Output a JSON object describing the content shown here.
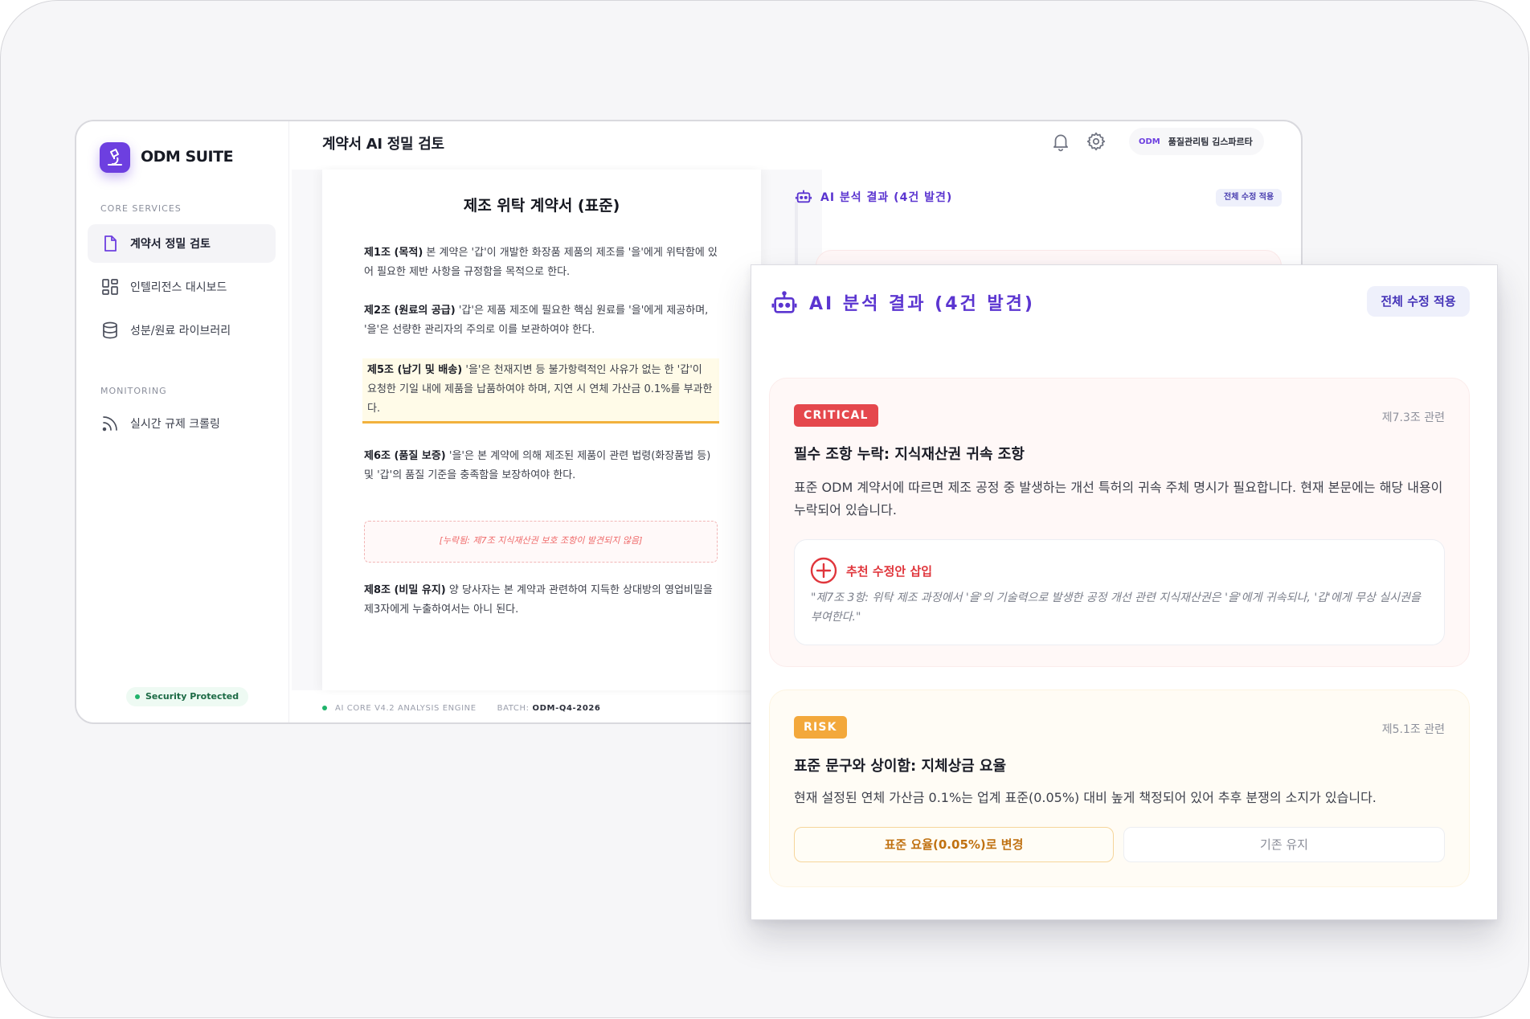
{
  "app": {
    "name": "ODM SUITE",
    "page_title": "계약서 AI 정밀 검토"
  },
  "sidebar": {
    "section_core": "CORE SERVICES",
    "section_monitoring": "MONITORING",
    "items": [
      {
        "label": "계약서 정밀 검토",
        "icon": "document-icon",
        "active": true
      },
      {
        "label": "인텔리전스 대시보드",
        "icon": "dashboard-grid-icon"
      },
      {
        "label": "성분/원료 라이브러리",
        "icon": "database-icon"
      },
      {
        "label": "실시간 규제 크롤링",
        "icon": "rss-feed-icon"
      }
    ],
    "security_label": "Security Protected"
  },
  "header": {
    "user_badge": "ODM",
    "user_name": "품질관리팀 김스파르타",
    "icons": [
      "bell-icon",
      "gear-icon"
    ]
  },
  "document": {
    "title": "제조 위탁 계약서 (표준)",
    "clauses": [
      {
        "head": "제1조 (목적)",
        "text": " 본 계약은 '갑'이 개발한 화장품 제품의 제조를 '을'에게 위탁함에 있어 필요한 제반 사항을 규정함을 목적으로 한다."
      },
      {
        "head": "제2조 (원료의 공급)",
        "text": " '갑'은 제품 제조에 필요한 핵심 원료를 '을'에게 제공하며, '을'은 선량한 관리자의 주의로 이를 보관하여야 한다."
      },
      {
        "head": "제5조 (납기 및 배송)",
        "text": " '을'은 천재지변 등 불가항력적인 사유가 없는 한 '갑'이 요청한 기일 내에 제품을 납품하여야 하며, 지연 시 연체 가산금 0.1%를 부과한다."
      },
      {
        "head": "제6조 (품질 보증)",
        "text": " '을'은 본 계약에 의해 제조된 제품이 관련 법령(화장품법 등) 및 '갑'의 품질 기준을 충족함을 보장하여야 한다."
      },
      {
        "head": "제8조 (비밀 유지)",
        "text": " 양 당사자는 본 계약과 관련하여 지득한 상대방의 영업비밀을 제3자에게 누출하여서는 아니 된다."
      }
    ],
    "missing_note": "[누락됨: 제7조 지식재산권 보호 조항이 발견되지 않음]"
  },
  "footer": {
    "engine": "AI CORE V4.2 ANALYSIS ENGINE",
    "batch_label": "BATCH:",
    "batch_value": "ODM-Q4-2026"
  },
  "analysis": {
    "title": "AI 분석 결과 (4건 발견)",
    "apply_all": "전체 수정 적용",
    "cards": [
      {
        "severity": "CRITICAL",
        "color": "#e5484d",
        "ref": "제7.3조 관련",
        "title": "필수 조항 누락: 지식재산권 귀속 조항",
        "desc": "표준 ODM 계약서에 따르면 제조 공정 중 발생하는 개선 특허의 귀속 주체 명시가 필요합니다. 현재 본문에는 해당 내용이 누락되어 있습니다.",
        "suggestion_label": "추천 수정안 삽입",
        "suggestion": "\"제7조 3항: 위탁 제조 과정에서 '을'의 기술력으로 발생한 공정 개선 관련 지식재산권은 '을'에게 귀속되나, '갑'에게 무상 실시권을 부여한다.\""
      },
      {
        "severity": "RISK",
        "color": "#f3a83b",
        "ref": "제5.1조 관련",
        "title": "표준 문구와 상이함: 지체상금 요율",
        "desc": "현재 설정된 연체 가산금 0.1%는 업계 표준(0.05%) 대비 높게 책정되어 있어 추후 분쟁의 소지가 있습니다.",
        "btn_primary": "표준 요율(0.05%)로 변경",
        "btn_secondary": "기존 유지"
      }
    ]
  },
  "colors": {
    "accent": "#6d3fe0",
    "critical": "#e5484d",
    "risk": "#f3a83b",
    "success": "#20b36b"
  }
}
